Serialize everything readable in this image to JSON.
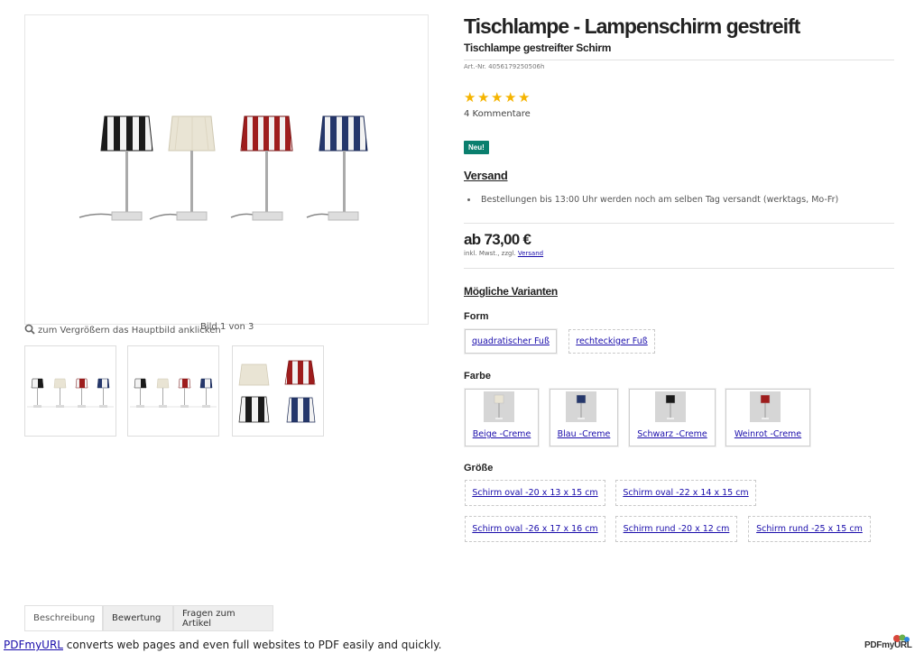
{
  "product": {
    "title": "Tischlampe - Lampenschirm gestreift",
    "subtitle": "Tischlampe gestreifter Schirm",
    "art_nr": "Art.-Nr. 4056179250506h",
    "rating": 5,
    "comments": "4 Kommentare",
    "badge": "Neu!",
    "price": "ab 73,00 €",
    "tax_prefix": "inkl. Mwst., zzgl.",
    "tax_link": "Versand"
  },
  "gallery": {
    "zoom_hint": "zum Vergrößern das Hauptbild anklicken",
    "image_counter": "Bild 1 von 3",
    "lamp_colors": [
      "#1a1a1a",
      "#e9e4d4",
      "#9e1d1d",
      "#25376b"
    ]
  },
  "shipping": {
    "heading": "Versand",
    "items": [
      "Bestellungen bis 13:00 Uhr werden noch am selben Tag versandt (werktags, Mo-Fr)"
    ]
  },
  "variants": {
    "heading": "Mögliche Varianten",
    "form_label": "Form",
    "form_options": [
      "quadratischer Fuß",
      "rechteckiger Fuß"
    ],
    "farbe_label": "Farbe",
    "farbe_options": [
      "Beige -Creme",
      "Blau -Creme",
      "Schwarz -Creme",
      "Weinrot -Creme"
    ],
    "groesse_label": "Größe",
    "groesse_options": [
      "Schirm oval -20 x 13 x 15 cm",
      "Schirm oval -22 x 14 x 15 cm",
      "Schirm oval -26 x 17 x 16 cm",
      "Schirm rund -20 x 12 cm",
      "Schirm rund -25 x 15 cm"
    ]
  },
  "tabs": [
    "Beschreibung",
    "Bewertung",
    "Fragen zum Artikel"
  ],
  "footer": {
    "link": "PDFmyURL",
    "text": " converts web pages and even full websites to PDF easily and quickly.",
    "logo": "PDFmyURL"
  },
  "colors": {
    "link": "#1a0dab",
    "badge": "#0a7f6e",
    "star": "#f5b400"
  }
}
